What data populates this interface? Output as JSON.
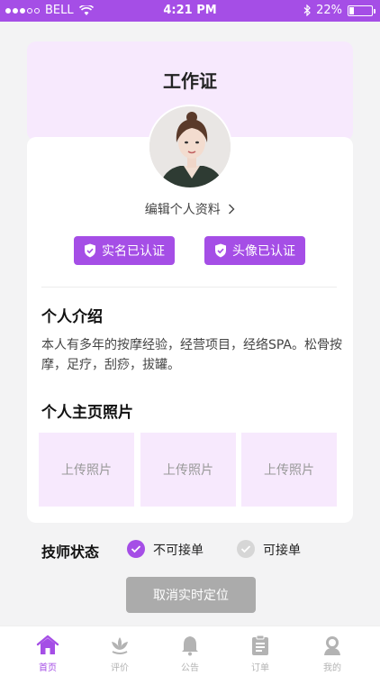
{
  "status_bar": {
    "carrier": "BELL",
    "time": "4:21 PM",
    "battery_percent": "22%",
    "battery_level": 0.22
  },
  "header": {
    "title": "工作证"
  },
  "profile": {
    "edit_link": "编辑个人资料",
    "badges": [
      "实名已认证",
      "头像已认证"
    ]
  },
  "intro": {
    "title": "个人介绍",
    "text": "本人有多年的按摩经验，经营项目，经络SPA。松骨按摩，足疗，刮痧，拔罐。"
  },
  "photos": {
    "title": "个人主页照片",
    "slots": [
      "上传照片",
      "上传照片",
      "上传照片"
    ]
  },
  "status": {
    "label": "技师状态",
    "options": [
      {
        "label": "不可接单",
        "checked": true
      },
      {
        "label": "可接单",
        "checked": false
      }
    ]
  },
  "cancel_button": "取消实时定位",
  "tabs": [
    {
      "label": "首页",
      "icon": "home-icon",
      "active": true
    },
    {
      "label": "评价",
      "icon": "lotus-icon",
      "active": false
    },
    {
      "label": "公告",
      "icon": "bell-icon",
      "active": false
    },
    {
      "label": "订单",
      "icon": "clipboard-icon",
      "active": false
    },
    {
      "label": "我的",
      "icon": "user-icon",
      "active": false
    }
  ],
  "colors": {
    "accent": "#a54ee6",
    "header_bg": "#f7e9fd",
    "disabled_button": "#ababab",
    "tab_inactive": "#b3b3b3"
  }
}
